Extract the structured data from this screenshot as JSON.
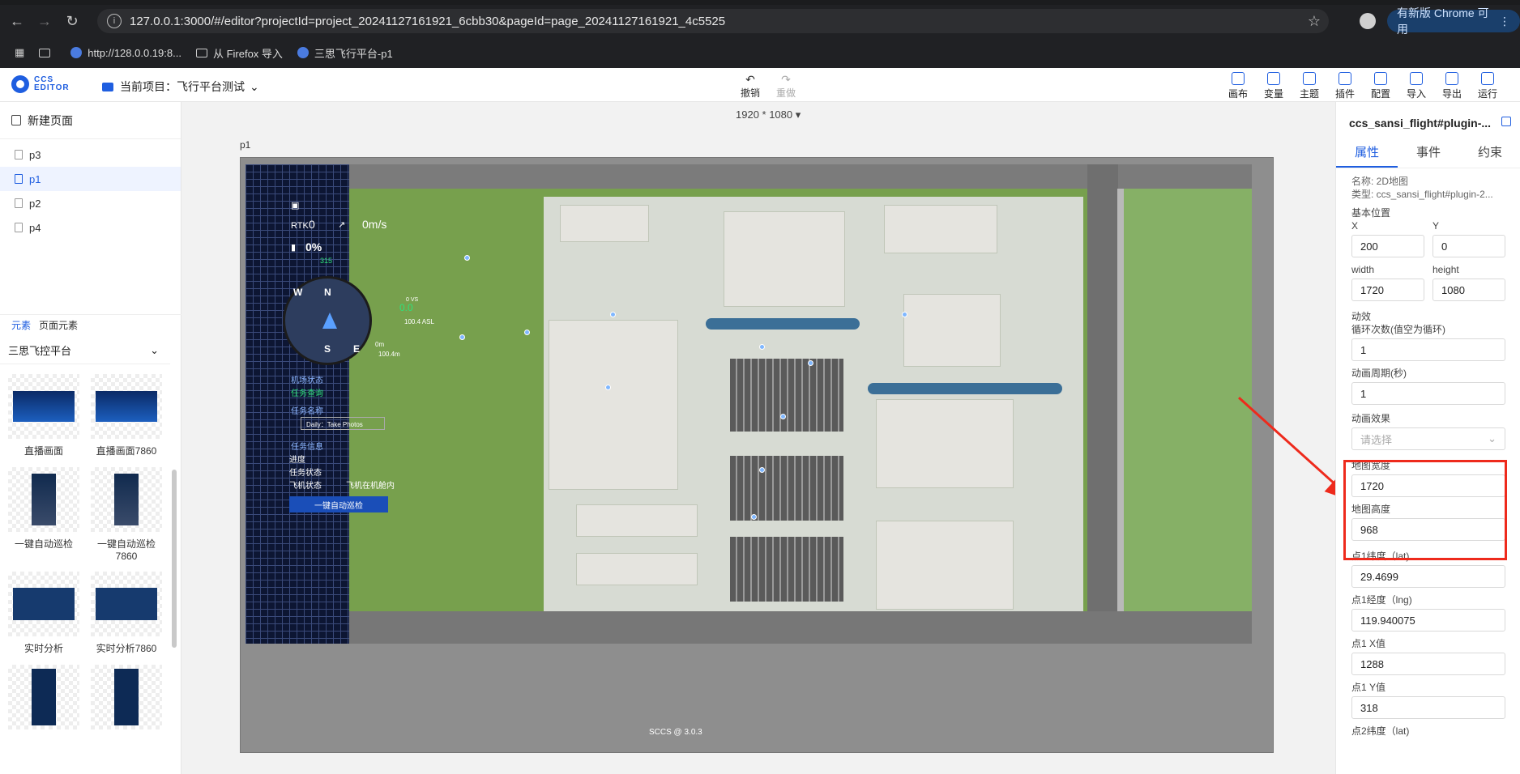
{
  "browser": {
    "url": "127.0.0.1:3000/#/editor?projectId=project_20241127161921_6cbb30&pageId=page_20241127161921_4c5525",
    "update_label": "有新版 Chrome 可用",
    "bookmarks": [
      "http://128.0.0.19:8...",
      "从 Firefox 导入",
      "三思飞行平台-p1"
    ]
  },
  "appbar": {
    "logo_text_1": "CCS",
    "logo_text_2": "EDITOR",
    "project_label": "当前项目：飞行平台测试",
    "undo": "撤销",
    "redo": "重做",
    "tools": [
      "画布",
      "变量",
      "主题",
      "插件",
      "配置",
      "导入",
      "导出",
      "运行"
    ]
  },
  "left": {
    "new_page": "新建页面",
    "pages": [
      "p3",
      "p1",
      "p2",
      "p4"
    ],
    "tabs": [
      "元素",
      "页面元素"
    ],
    "group": "三思飞控平台",
    "components": [
      "直播画面",
      "直播画面7860",
      "一键自动巡检",
      "一键自动巡检7860",
      "实时分析",
      "实时分析7860"
    ]
  },
  "canvas": {
    "size": "1920 * 1080",
    "page_label": "p1",
    "footer": "SCCS @ 3.0.3",
    "hud": {
      "rtk": "0",
      "battery": "0%",
      "speed": "0m/s",
      "heading": "315",
      "alt": "0.0",
      "asl": "100.4 ASL",
      "vs": "0 VS",
      "height": "0m",
      "height2": "100.4m",
      "airport_status": "机场状态",
      "task_query": "任务查询",
      "task_name": "任务名称",
      "task_name_value": "Daily：Take Photos",
      "task_info": "任务信息",
      "progress": "进度",
      "task_state": "任务状态",
      "plane_state": "飞机状态",
      "plane_state_value": "飞机在机舱内",
      "task_button": "一键自动巡检",
      "compass_n": "N",
      "compass_s": "S",
      "compass_e": "E",
      "compass_w": "W"
    }
  },
  "right": {
    "title": "ccs_sansi_flight#plugin-...",
    "tabs": [
      "属性",
      "事件",
      "约束"
    ],
    "name_line": "名称: 2D地图",
    "type_line": "类型: ccs_sansi_flight#plugin-2...",
    "base_pos": "基本位置",
    "x_label": "X",
    "y_label": "Y",
    "x": "200",
    "y": "0",
    "width_label": "width",
    "height_label": "height",
    "width": "1720",
    "height": "1080",
    "anim": "动效",
    "loop_label": "循环次数(值空为循环)",
    "loop": "1",
    "period_label": "动画周期(秒)",
    "period": "1",
    "effect_label": "动画效果",
    "effect_placeholder": "请选择",
    "map_w_label": "地图宽度",
    "map_w": "1720",
    "map_h_label": "地图高度",
    "map_h": "968",
    "p1lat_label": "点1纬度（lat)",
    "p1lat": "29.4699",
    "p1lng_label": "点1经度（lng)",
    "p1lng": "119.940075",
    "p1x_label": "点1 X值",
    "p1x": "1288",
    "p1y_label": "点1 Y值",
    "p1y": "318",
    "p2lat_label": "点2纬度（lat)"
  },
  "colors": {
    "accent": "#1f5ee0",
    "highlight": "#ee2a1c"
  }
}
